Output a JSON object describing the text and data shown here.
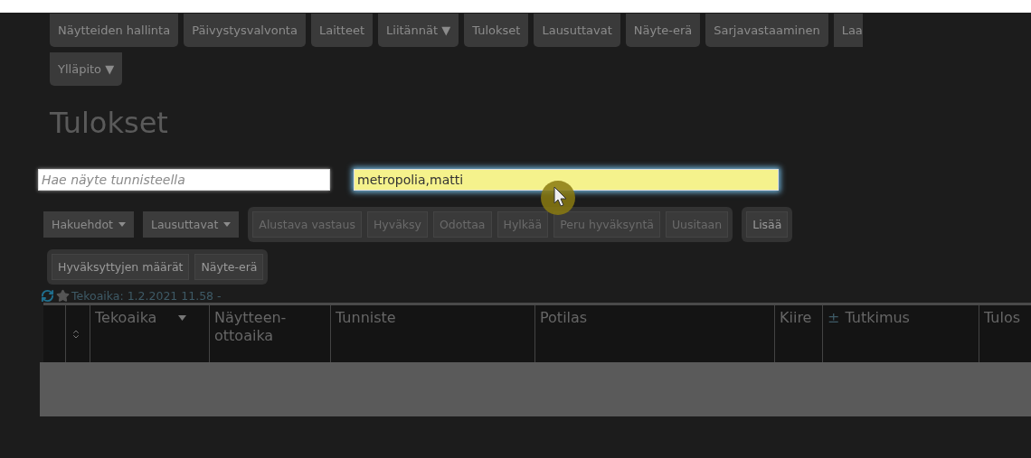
{
  "nav": [
    {
      "label": "Näytteiden hallinta"
    },
    {
      "label": "Päivystysvalvonta"
    },
    {
      "label": "Laitteet"
    },
    {
      "label": "Liitännät ▼"
    },
    {
      "label": "Tulokset"
    },
    {
      "label": "Lausuttavat"
    },
    {
      "label": "Näyte-erä"
    },
    {
      "label": "Sarjavastaaminen"
    },
    {
      "label": "Laa"
    },
    {
      "label": "Ylläpito ▼"
    }
  ],
  "title": "Tulokset",
  "search": {
    "placeholder": "Hae näyte tunnisteella"
  },
  "patient_search": {
    "value": "metropolia,matti",
    "focused": true
  },
  "filters": [
    {
      "label": "Hakuehdot"
    },
    {
      "label": "Lausuttavat"
    }
  ],
  "actions": [
    {
      "label": "Alustava vastaus",
      "disabled": true
    },
    {
      "label": "Hyväksy",
      "disabled": true
    },
    {
      "label": "Odottaa",
      "disabled": true
    },
    {
      "label": "Hylkää",
      "disabled": true
    },
    {
      "label": "Peru hyväksyntä",
      "disabled": true
    },
    {
      "label": "Uusitaan",
      "disabled": true
    }
  ],
  "extra_actions": [
    {
      "label": "Lisää",
      "disabled": false
    }
  ],
  "reports": [
    {
      "label": "Hyväksyttyjen määrät",
      "disabled": false
    },
    {
      "label": "Näyte-erä",
      "disabled": false
    }
  ],
  "filter_summary": "Tekoaika: 1.2.2021 11.58 -",
  "table": {
    "columns": [
      {
        "kind": "blank"
      },
      {
        "kind": "sort"
      },
      {
        "kind": "text",
        "label": "Tekoaika",
        "sorted": true
      },
      {
        "kind": "text",
        "label": "Näytteen-ottoaika",
        "sorted": false
      },
      {
        "kind": "text",
        "label": "Tunniste",
        "sorted": false
      },
      {
        "kind": "text",
        "label": "Potilas",
        "sorted": false
      },
      {
        "kind": "text",
        "label": "Kiire",
        "sorted": false
      },
      {
        "kind": "text",
        "label": "Tutkimus",
        "prefix": "±",
        "sorted": false
      },
      {
        "kind": "text",
        "label": "Tulos",
        "sorted": false
      }
    ]
  }
}
